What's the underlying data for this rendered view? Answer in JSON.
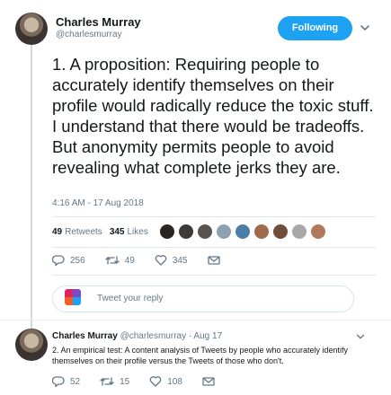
{
  "author": {
    "name": "Charles Murray",
    "handle": "@charlesmurray"
  },
  "follow_label": "Following",
  "tweet": {
    "text": "1. A proposition: Requiring people to accurately identify themselves on their profile would radically reduce the toxic stuff. I understand that there would be tradeoffs. But anonymity permits people to avoid revealing what complete jerks they are.",
    "timestamp": "4:16 AM - 17 Aug 2018",
    "retweets_count": "49",
    "retweets_label": "Retweets",
    "likes_count": "345",
    "likes_label": "Likes",
    "actions": {
      "replies": "256",
      "retweets": "49",
      "likes": "345"
    }
  },
  "liker_colors": [
    "#2b2522",
    "#3d3a38",
    "#5a524c",
    "#8fa0b0",
    "#4a7ea8",
    "#a06a4c",
    "#6e4e3a",
    "#a8a8a8",
    "#b07a5a"
  ],
  "reply_box": {
    "placeholder": "Tweet your reply"
  },
  "reply_tweet": {
    "name": "Charles Murray",
    "meta": "@charlesmurray · Aug 17",
    "text": "2. An empirical test: A content analysis of Tweets by people who accurately identify themselves on their profile versus the Tweets of those who don't.",
    "actions": {
      "replies": "52",
      "retweets": "15",
      "likes": "108"
    }
  },
  "colors": {
    "accent": "#1da1f2",
    "muted": "#657786",
    "text": "#14171a"
  }
}
